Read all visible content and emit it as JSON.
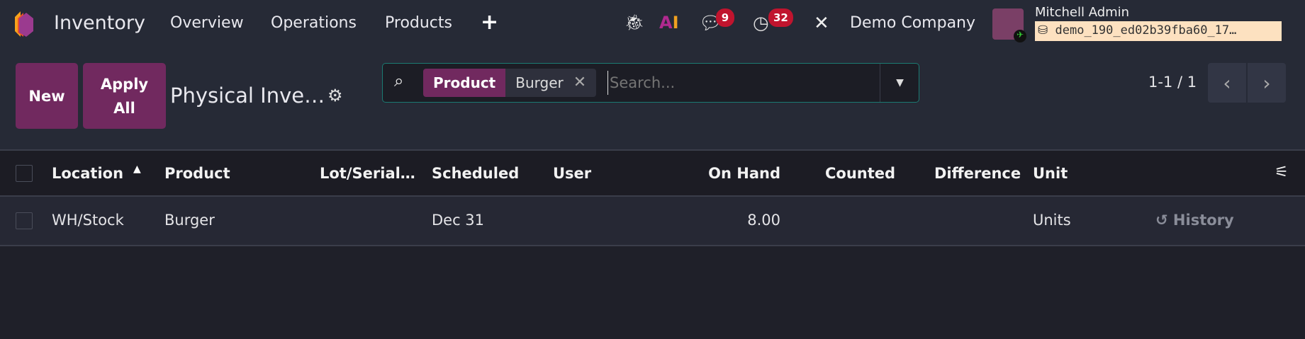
{
  "navbar": {
    "app_name": "Inventory",
    "menu": [
      "Overview",
      "Operations",
      "Products"
    ],
    "chat_count": "9",
    "activity_count": "32",
    "company": "Demo Company",
    "user_name": "Mitchell Admin",
    "database": "demo_190_ed02b39fba60_17…"
  },
  "control": {
    "new_label": "New",
    "apply_all_label": "Apply All",
    "title": "Physical Inve…",
    "search": {
      "facet_label": "Product",
      "facet_value": "Burger",
      "placeholder": "Search..."
    },
    "pager": "1-1 / 1"
  },
  "table": {
    "columns": [
      "Location",
      "Product",
      "Lot/Serial…",
      "Scheduled",
      "User",
      "On Hand",
      "Counted",
      "Difference",
      "Unit"
    ],
    "rows": [
      {
        "location": "WH/Stock",
        "product": "Burger",
        "lot": "",
        "scheduled": "Dec 31",
        "user": "",
        "on_hand": "8.00",
        "counted": "",
        "difference": "",
        "unit": "Units",
        "history": "History"
      }
    ]
  },
  "colors": {
    "brand": "#71295f",
    "badge": "#c0142e",
    "search_border": "#1b7a72"
  }
}
